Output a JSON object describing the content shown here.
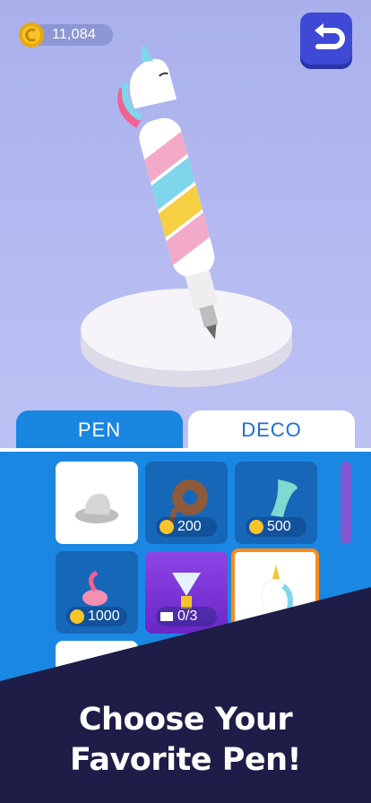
{
  "hud": {
    "coins": "11,084"
  },
  "tabs": [
    {
      "label": "PEN"
    },
    {
      "label": "DECO"
    }
  ],
  "items": [
    {
      "name": "hat",
      "price": ""
    },
    {
      "name": "donut",
      "price": "200"
    },
    {
      "name": "mermaid-tail",
      "price": "500"
    },
    {
      "name": "flamingo",
      "price": "1000"
    },
    {
      "name": "diamond-trophy",
      "progress": "0/3"
    },
    {
      "name": "unicorn",
      "price": ""
    }
  ],
  "banner": {
    "line1": "Choose Your",
    "line2": "Favorite Pen!"
  },
  "colors": {
    "accent": "#1a88e3",
    "dark_banner": "#1e1d47",
    "selected_border": "#ff8a1a"
  }
}
